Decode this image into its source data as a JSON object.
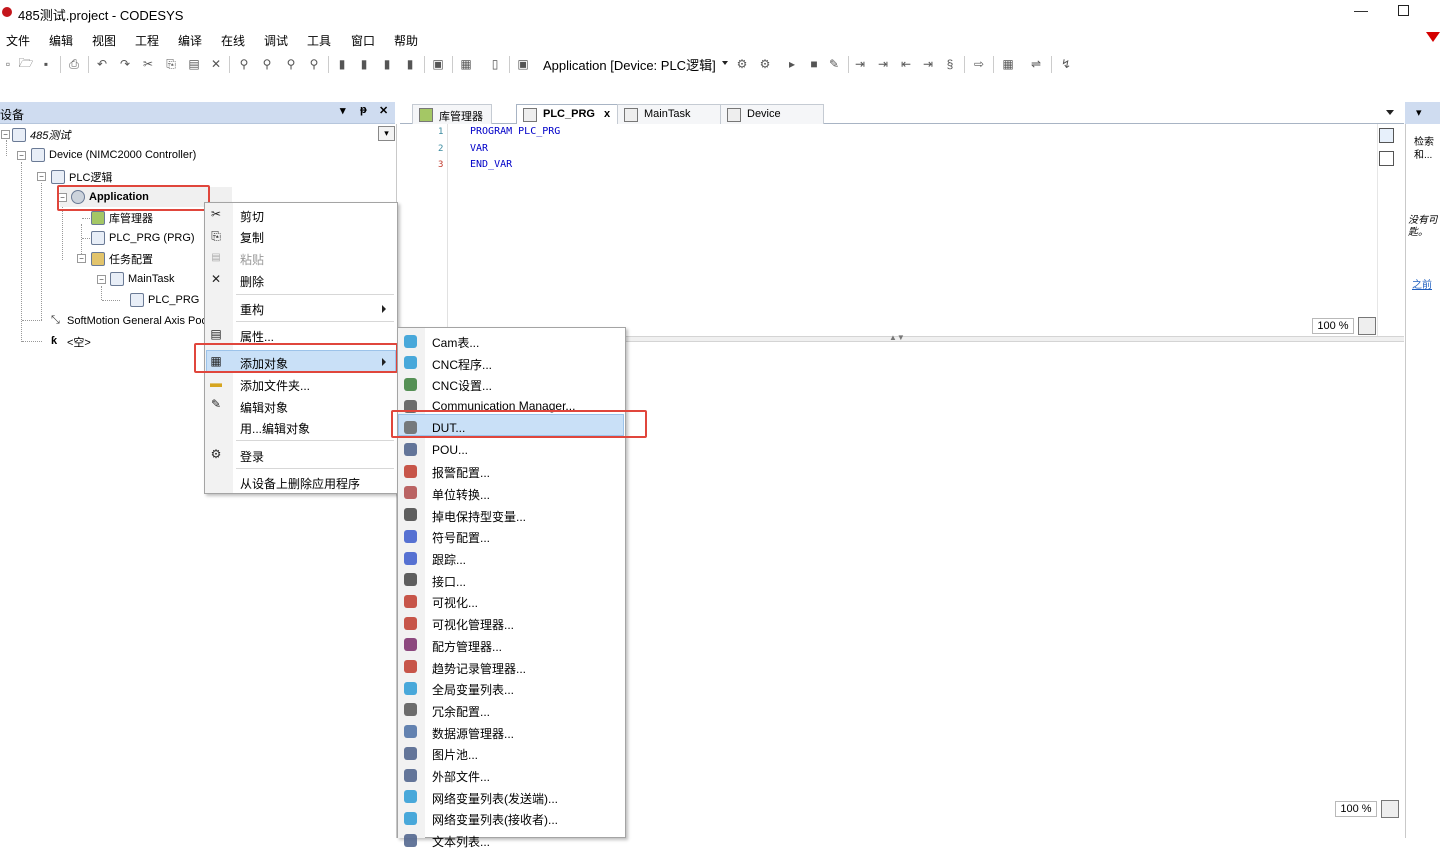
{
  "window": {
    "title": "485测试.project - CODESYS",
    "minimize": "—",
    "maximize": ""
  },
  "menu": [
    "文件",
    "编辑",
    "视图",
    "工程",
    "编译",
    "在线",
    "调试",
    "工具",
    "窗口",
    "帮助"
  ],
  "toolbar": {
    "active_application": "Application [Device: PLC逻辑]"
  },
  "devices_panel": {
    "title": "设备",
    "header_buttons": [
      "▾",
      "ᵽ",
      "✕"
    ],
    "tree": [
      {
        "label": "485测试",
        "icon": "project-icon"
      },
      {
        "label": "Device (NIMC2000 Controller)",
        "icon": "device-icon"
      },
      {
        "label": "PLC逻辑",
        "icon": "plc-logic-icon"
      },
      {
        "label": "Application",
        "icon": "application-gear-icon"
      },
      {
        "label": "库管理器",
        "icon": "library-manager-icon"
      },
      {
        "label": "PLC_PRG (PRG)",
        "icon": "program-icon"
      },
      {
        "label": "任务配置",
        "icon": "task-config-icon"
      },
      {
        "label": "MainTask",
        "icon": "task-icon"
      },
      {
        "label": "PLC_PRG",
        "icon": "program-call-icon"
      },
      {
        "label": "SoftMotion General Axis Poc",
        "icon": "axis-pool-icon"
      },
      {
        "label": "<空>",
        "icon": "empty-slot-icon"
      }
    ]
  },
  "editor": {
    "tabs": [
      {
        "label": "库管理器",
        "active": false
      },
      {
        "label": "PLC_PRG",
        "active": true,
        "close": "x"
      },
      {
        "label": "MainTask",
        "active": false
      },
      {
        "label": "Device",
        "active": false
      }
    ],
    "line_numbers": [
      "1",
      "2",
      "3"
    ],
    "code_lines": [
      "PROGRAM PLC_PRG",
      "VAR",
      "END_VAR"
    ],
    "zoom_top": "100 %",
    "zoom_bottom": "100 %"
  },
  "right_panel": {
    "lines": [
      "检索",
      "和...",
      "没有可",
      "匙。",
      "之前"
    ]
  },
  "context_menu": [
    {
      "label": "剪切",
      "icon": "cut-icon",
      "glyph": "✂"
    },
    {
      "label": "复制",
      "icon": "copy-icon",
      "glyph": "⎘"
    },
    {
      "label": "粘贴",
      "icon": "paste-icon",
      "glyph": "📋",
      "disabled": true
    },
    {
      "label": "删除",
      "icon": "delete-icon",
      "glyph": "✕"
    },
    {
      "label": "重构",
      "icon": "",
      "glyph": "",
      "submenu": true
    },
    {
      "label": "属性...",
      "icon": "properties-icon",
      "glyph": "▤"
    },
    {
      "label": "添加对象",
      "icon": "add-object-icon",
      "glyph": "▦",
      "submenu": true,
      "highlighted": true
    },
    {
      "label": "添加文件夹...",
      "icon": "folder-icon",
      "glyph": "🗀"
    },
    {
      "label": "编辑对象",
      "icon": "edit-object-icon",
      "glyph": "✎"
    },
    {
      "label": "用...编辑对象",
      "icon": "",
      "glyph": ""
    },
    {
      "label": "登录",
      "icon": "login-icon",
      "glyph": "⚙"
    },
    {
      "label": "从设备上删除应用程序",
      "icon": "",
      "glyph": ""
    }
  ],
  "add_object_submenu": [
    {
      "label": "Cam表...",
      "icon": "cam-table-icon",
      "color": "#2a9bd6"
    },
    {
      "label": "CNC程序...",
      "icon": "cnc-program-icon",
      "color": "#2a9bd6"
    },
    {
      "label": "CNC设置...",
      "icon": "cnc-settings-icon",
      "color": "#3a7f3a"
    },
    {
      "label": "Communication Manager...",
      "icon": "communication-manager-icon",
      "color": "#555555"
    },
    {
      "label": "DUT...",
      "icon": "dut-icon",
      "color": "#666666",
      "highlighted": true
    },
    {
      "label": "POU...",
      "icon": "pou-icon",
      "color": "#4a5f8a"
    },
    {
      "label": "报警配置...",
      "icon": "alarm-config-icon",
      "color": "#c0392b"
    },
    {
      "label": "单位转换...",
      "icon": "unit-conversion-icon",
      "color": "#b04a4a"
    },
    {
      "label": "掉电保持型变量...",
      "icon": "persistent-vars-icon",
      "color": "#444444"
    },
    {
      "label": "符号配置...",
      "icon": "symbol-config-icon",
      "color": "#3b5bcc"
    },
    {
      "label": "跟踪...",
      "icon": "trace-icon",
      "color": "#3b5bcc"
    },
    {
      "label": "接口...",
      "icon": "interface-icon",
      "color": "#444444"
    },
    {
      "label": "可视化...",
      "icon": "visualization-icon",
      "color": "#c0392b"
    },
    {
      "label": "可视化管理器...",
      "icon": "visualization-manager-icon",
      "color": "#c0392b"
    },
    {
      "label": "配方管理器...",
      "icon": "recipe-manager-icon",
      "color": "#7a2a6a"
    },
    {
      "label": "趋势记录管理器...",
      "icon": "trend-manager-icon",
      "color": "#c0392b"
    },
    {
      "label": "全局变量列表...",
      "icon": "gvl-icon",
      "color": "#2a9bd6"
    },
    {
      "label": "冗余配置...",
      "icon": "redundancy-config-icon",
      "color": "#555555"
    },
    {
      "label": "数据源管理器...",
      "icon": "datasource-manager-icon",
      "color": "#4a6fa5"
    },
    {
      "label": "图片池...",
      "icon": "image-pool-icon",
      "color": "#4a5f8a"
    },
    {
      "label": "外部文件...",
      "icon": "external-file-icon",
      "color": "#4a5f8a"
    },
    {
      "label": "网络变量列表(发送端)...",
      "icon": "nvl-sender-icon",
      "color": "#2a9bd6"
    },
    {
      "label": "网络变量列表(接收者)...",
      "icon": "nvl-receiver-icon",
      "color": "#2a9bd6"
    },
    {
      "label": "文本列表...",
      "icon": "text-list-icon",
      "color": "#4a5f8a"
    }
  ]
}
